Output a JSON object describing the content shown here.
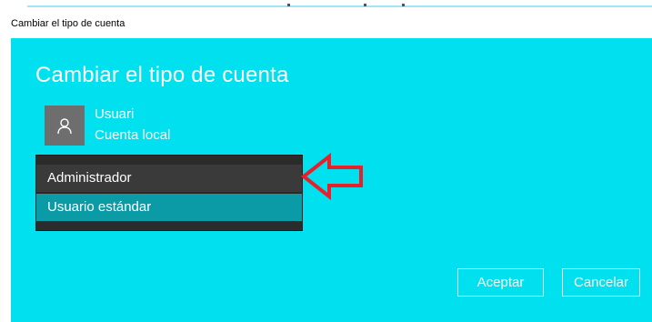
{
  "window": {
    "title": "Cambiar el tipo de cuenta"
  },
  "dialog": {
    "heading": "Cambiar el tipo de cuenta",
    "user": {
      "name": "Usuari",
      "account_type": "Cuenta local",
      "avatar_icon": "person-icon"
    },
    "account_type_dropdown": {
      "options": [
        "Administrador",
        "Usuario estándar"
      ],
      "selected": "Usuario estándar",
      "highlighted": "Administrador"
    },
    "annotation": {
      "icon": "red-arrow-left-icon",
      "color": "#e8202a"
    },
    "buttons": {
      "accept": "Aceptar",
      "cancel": "Cancelar"
    }
  },
  "colors": {
    "dialog_background": "#00e0ee",
    "dropdown_background": "#2b2b2b",
    "selected_option": "#0a9ba6"
  }
}
